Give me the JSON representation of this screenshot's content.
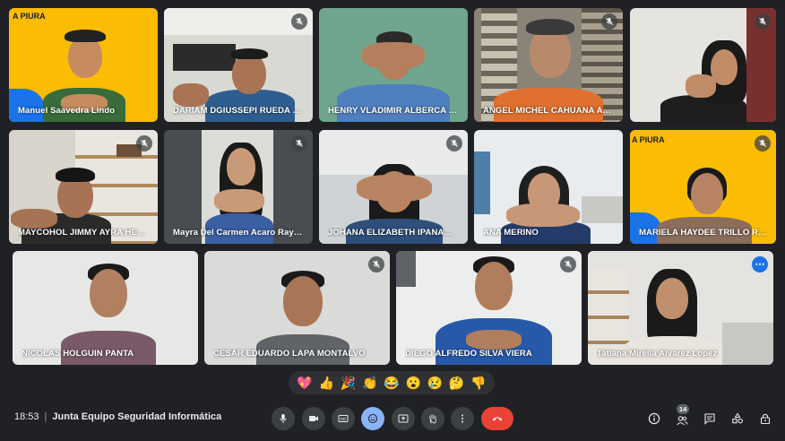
{
  "meeting": {
    "time": "18:53",
    "title": "Junta Equipo Seguridad Informática"
  },
  "participants_count": "14",
  "tile_logo": "A PIURA",
  "participants": [
    {
      "name": "Manuel Saavedra Lindo",
      "muted": false
    },
    {
      "name": "DARIAM DGIUSSEPI RUEDA ME...",
      "muted": true
    },
    {
      "name": "HENRY VLADIMIR ALBERCA GO...",
      "muted": false
    },
    {
      "name": "ANGEL MICHEL CAHUANA AUQ...",
      "muted": true
    },
    {
      "name": "",
      "muted": true
    },
    {
      "name": "MAYCOHOL JIMMY AYRA HERR...",
      "muted": true
    },
    {
      "name": "Mayra Del Carmen Acaro Raymu...",
      "muted": true
    },
    {
      "name": "JOHANA ELIZABETH IPANAQUE...",
      "muted": true
    },
    {
      "name": "ANA MERINO",
      "muted": false
    },
    {
      "name": "MARIELA HAYDEE TRILLO RAMOS",
      "muted": true
    },
    {
      "name": "NICOLAS HOLGUIN PANTA",
      "muted": false
    },
    {
      "name": "CESAR EDUARDO LAPA MONTALVO",
      "muted": true
    },
    {
      "name": "DIEGO ALFREDO SILVA VIERA",
      "muted": true
    },
    {
      "name": "Tatiana Mirella Alvarez Lopez",
      "muted": false
    }
  ],
  "reactions": [
    "💖",
    "👍",
    "🎉",
    "👏",
    "😂",
    "😮",
    "😢",
    "🤔",
    "👎"
  ],
  "colors": {
    "background": "#202124",
    "accent": "#8ab4f8",
    "hangup": "#ea4335",
    "brand_yellow": "#fbbc04",
    "active_more": "#1a73e8"
  },
  "controls": [
    "mic-icon",
    "camera-icon",
    "captions-icon",
    "emoji-icon",
    "present-icon",
    "raise-hand-icon",
    "more-options-icon",
    "hang-up-icon"
  ],
  "side_controls": [
    "info-icon",
    "people-icon",
    "chat-icon",
    "activities-icon",
    "host-controls-icon"
  ]
}
